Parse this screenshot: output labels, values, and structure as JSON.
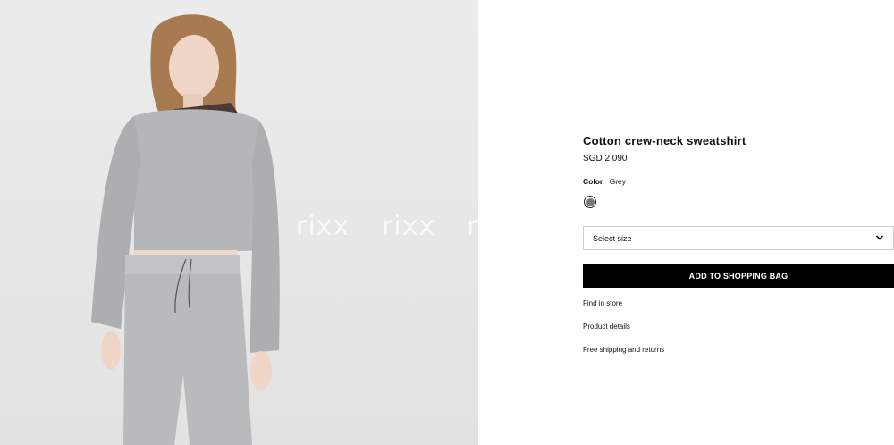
{
  "watermark": [
    "rixx",
    "rixx",
    "r"
  ],
  "product": {
    "title": "Cotton crew-neck sweatshirt",
    "price": "SGD 2,090",
    "color_label": "Color",
    "color_value": "Grey",
    "swatch_color": "#75777a",
    "size_placeholder": "Select size",
    "add_to_bag": "ADD TO SHOPPING BAG"
  },
  "links": [
    "Find in store",
    "Product details",
    "Free shipping and returns"
  ],
  "colors": {
    "button_bg": "#000000",
    "background": "#ffffff",
    "photo_bg": "#e8e8e8"
  }
}
